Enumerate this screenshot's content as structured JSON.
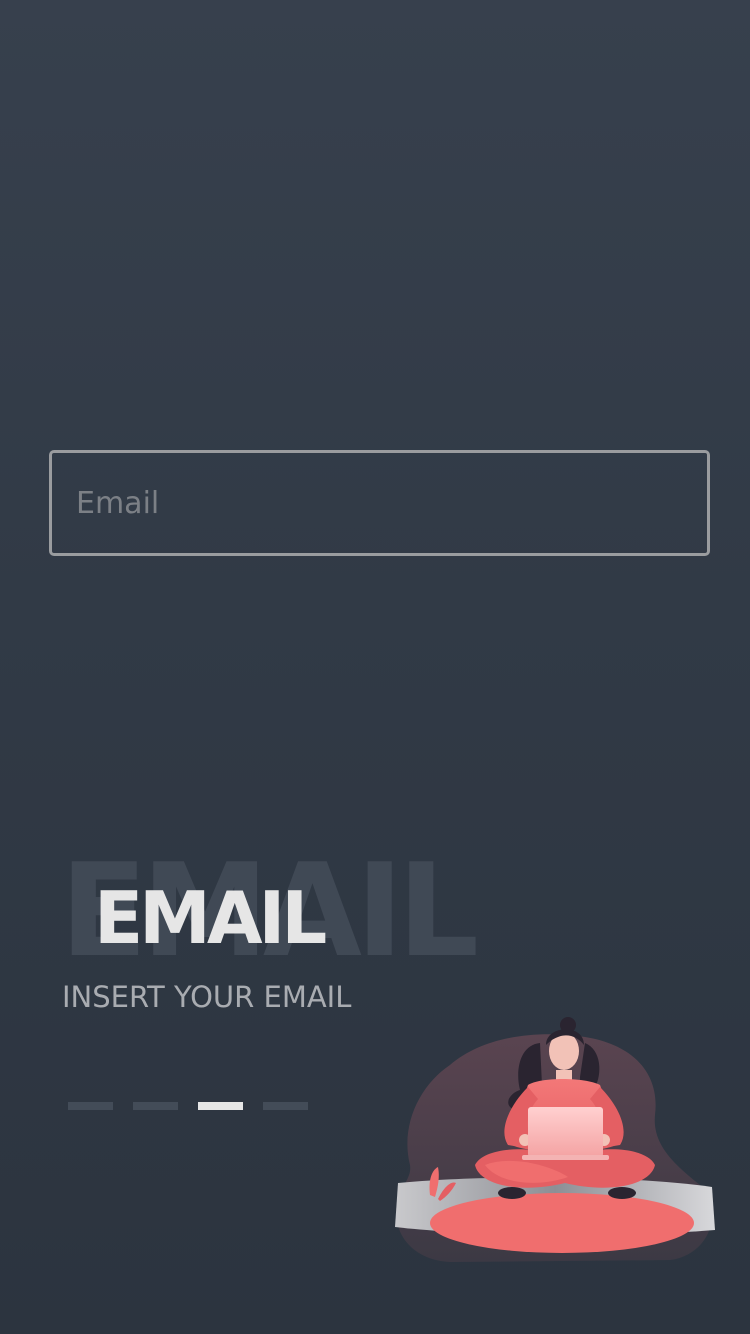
{
  "email_input": {
    "placeholder": "Email",
    "value": ""
  },
  "title": {
    "background": "EMAIL",
    "foreground": "EMAIL"
  },
  "subtitle": "INSERT YOUR EMAIL",
  "pager": {
    "total": 4,
    "active_index": 2
  },
  "colors": {
    "background": "#343c48",
    "accent": "#f06e6e",
    "title": "#e6e6e6",
    "pager_inactive": "#434c58"
  },
  "illustration": "woman-with-laptop-illustration"
}
